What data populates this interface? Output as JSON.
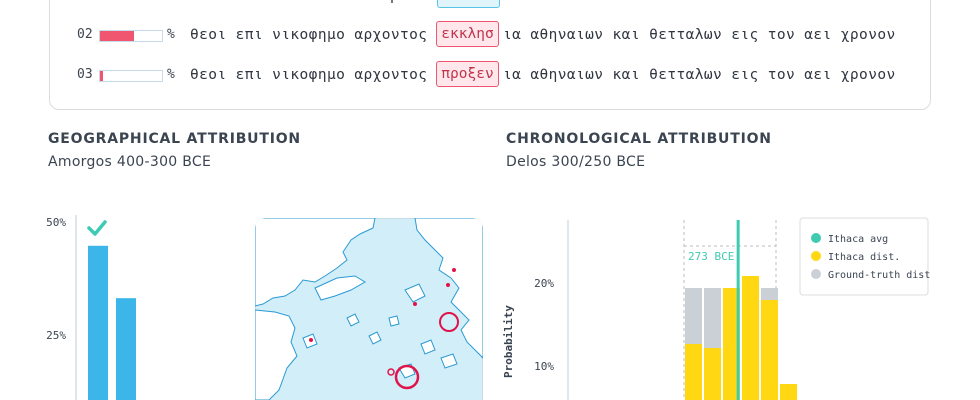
{
  "restoration": {
    "rows": [
      {
        "rank": "02",
        "prob": 0.55,
        "pct": "%",
        "before": "θεοι επι νικοφημο αρχοντος",
        "highlight": "εκκλησ",
        "after": "ια αθηναιων και θετταλων εις τον αει χρονον"
      },
      {
        "rank": "03",
        "prob": 0.05,
        "pct": "%",
        "before": "θεοι επι νικοφημο αρχοντος",
        "highlight": "προξεν",
        "after": "ια αθηναιων και θετταλων εις τον αει χρονον"
      }
    ]
  },
  "geographical": {
    "title": "GEOGRAPHICAL ATTRIBUTION",
    "subtitle": "Amorgos 400-300 BCE"
  },
  "chronological": {
    "title": "CHRONOLOGICAL ATTRIBUTION",
    "subtitle": "Delos 300/250 BCE"
  },
  "colors": {
    "bar_blue": "#3cb6e8",
    "teal": "#3ecbb2",
    "yellow": "#ffd813",
    "grey": "#cbcfd6",
    "red": "#e0144b",
    "map_sea": "#d2eef8",
    "map_coast": "#2a9ad4"
  },
  "chart_data": [
    {
      "type": "bar",
      "title": "GEOGRAPHICAL ATTRIBUTION",
      "ylim": [
        0,
        50
      ],
      "yticks": [
        "50%",
        "25%"
      ],
      "values": [
        45,
        34
      ],
      "check_icon": "check-icon"
    },
    {
      "type": "bar",
      "title": "CHRONOLOGICAL ATTRIBUTION",
      "ylabel": "Probability",
      "yticks": [
        "20%",
        "10%"
      ],
      "ylim": [
        0,
        24
      ],
      "annotation": "273 BCE",
      "legend_position": "top-right",
      "legend": [
        {
          "label": "Ithaca avg",
          "color": "#3ecbb2"
        },
        {
          "label": "Ithaca dist.",
          "color": "#ffd813"
        },
        {
          "label": "Ground-truth dist",
          "color": "#cbcfd6"
        }
      ],
      "series": [
        {
          "name": "Ithaca dist.",
          "values": [
            7,
            6.5,
            14,
            15.5,
            12.5,
            2
          ]
        },
        {
          "name": "Ground-truth dist",
          "values": [
            14,
            14,
            0,
            0,
            14,
            0
          ]
        }
      ],
      "avg_index": 2.85
    }
  ]
}
